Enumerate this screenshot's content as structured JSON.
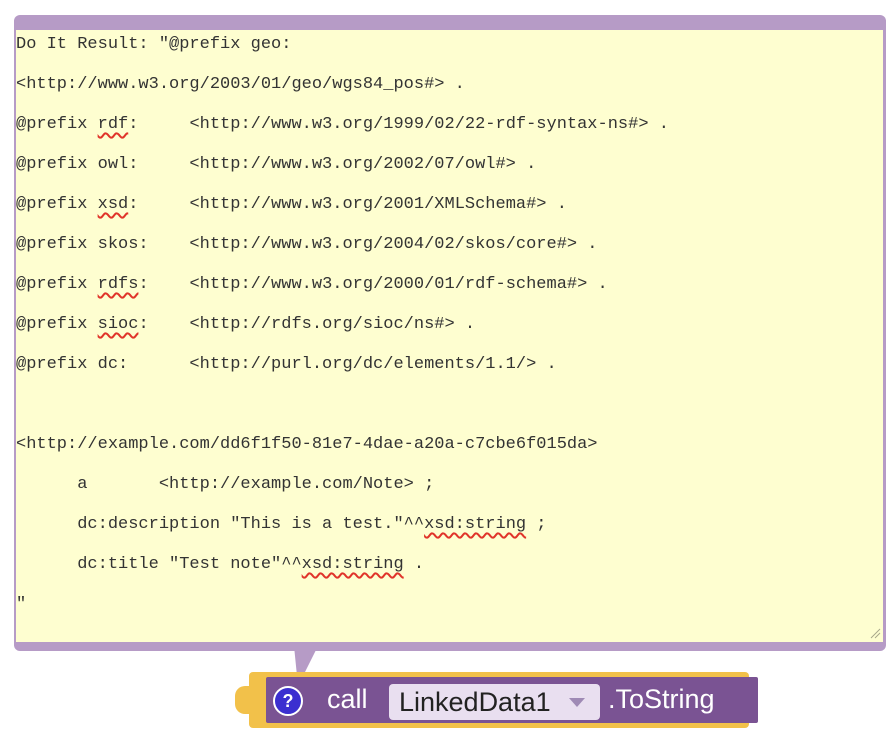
{
  "comment": {
    "lines": [
      {
        "parts": [
          "Do It Result: \"@prefix geo:"
        ]
      },
      {
        "parts": [
          "<http://www.w3.org/2003/01/geo/wgs84_pos#> ."
        ]
      },
      {
        "parts": [
          "@prefix ",
          "rdf",
          ":     <http://www.w3.org/1999/02/22-rdf-syntax-ns#> ."
        ]
      },
      {
        "parts": [
          "@prefix owl:     <http://www.w3.org/2002/07/owl#> ."
        ]
      },
      {
        "parts": [
          "@prefix ",
          "xsd",
          ":     <http://www.w3.org/2001/XMLSchema#> ."
        ]
      },
      {
        "parts": [
          "@prefix skos:    <http://www.w3.org/2004/02/skos/core#> ."
        ]
      },
      {
        "parts": [
          "@prefix ",
          "rdfs",
          ":    <http://www.w3.org/2000/01/rdf-schema#> ."
        ]
      },
      {
        "parts": [
          "@prefix ",
          "sioc",
          ":    <http://rdfs.org/sioc/ns#> ."
        ]
      },
      {
        "parts": [
          "@prefix dc:      <http://purl.org/dc/elements/1.1/> ."
        ]
      },
      {
        "parts": [
          ""
        ]
      },
      {
        "parts": [
          "<http://example.com/dd6f1f50-81e7-4dae-a20a-c7cbe6f015da>"
        ]
      },
      {
        "parts": [
          "      a       <http://example.com/Note> ;"
        ]
      },
      {
        "parts": [
          "      dc:description \"This is a test.\"^^",
          "xsd:string",
          " ;"
        ]
      },
      {
        "parts": [
          "      dc:title \"Test note\"^^",
          "xsd:string",
          " ."
        ]
      },
      {
        "parts": [
          "\""
        ]
      }
    ]
  },
  "block": {
    "help_icon": "?",
    "call_label": "call",
    "component": "LinkedData1",
    "method": ".ToString"
  },
  "colors": {
    "bubble_border": "#b69bc6",
    "bubble_fill": "#fefed0",
    "block_face": "#7a5393",
    "block_outline": "#f2c14a",
    "help_icon": "#3b2fd0"
  }
}
